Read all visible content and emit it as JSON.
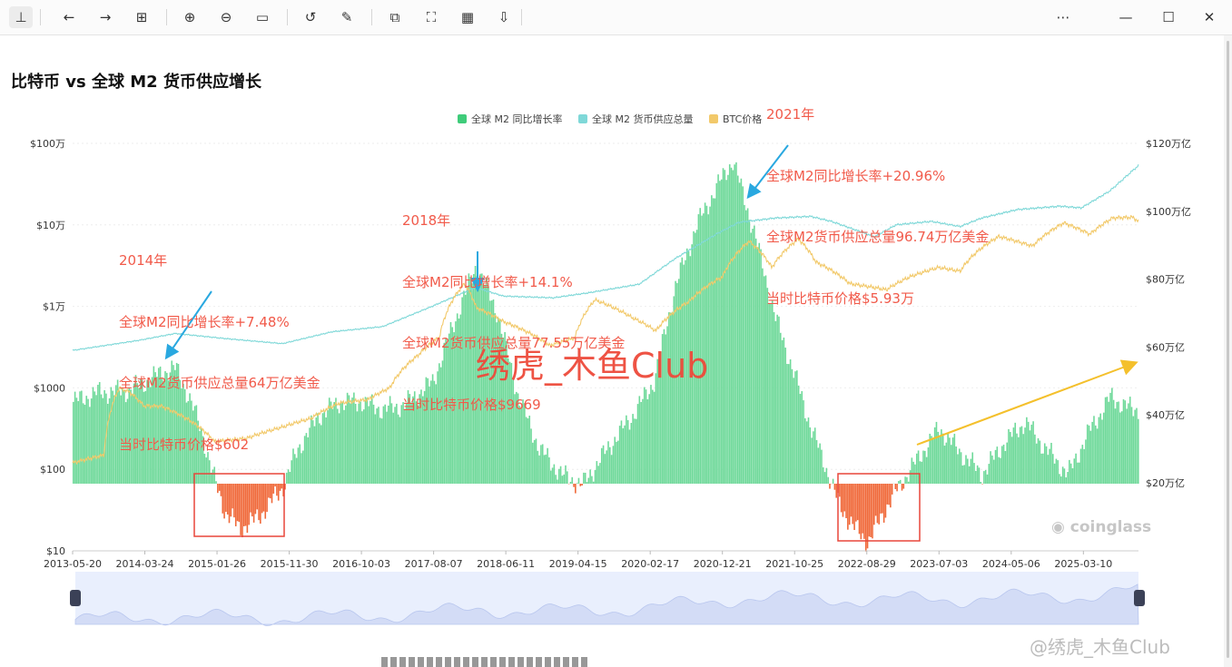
{
  "toolbar": {
    "items": [
      {
        "name": "pin-icon",
        "glyph": "⊥"
      },
      {
        "name": "back-icon",
        "glyph": "←"
      },
      {
        "name": "forward-icon",
        "glyph": "→"
      },
      {
        "name": "grid-icon",
        "glyph": "⊞"
      },
      {
        "name": "zoom-in-icon",
        "glyph": "⊕"
      },
      {
        "name": "zoom-out-icon",
        "glyph": "⊖"
      },
      {
        "name": "fit-icon",
        "glyph": "▭"
      },
      {
        "name": "rotate-icon",
        "glyph": "↺"
      },
      {
        "name": "edit-icon",
        "glyph": "✎"
      },
      {
        "name": "crop-icon",
        "glyph": "⧉"
      },
      {
        "name": "scan-icon",
        "glyph": "⛶"
      },
      {
        "name": "qr-icon",
        "glyph": "▦"
      },
      {
        "name": "download-icon",
        "glyph": "⇩"
      },
      {
        "name": "more-icon",
        "glyph": "⋯"
      },
      {
        "name": "minimize-icon",
        "glyph": "—"
      },
      {
        "name": "maximize-icon",
        "glyph": "☐"
      },
      {
        "name": "close-icon",
        "glyph": "✕"
      }
    ]
  },
  "page": {
    "watermark": "绣虎_木鱼Club",
    "logo": "coinglass",
    "source_watermark": "@绣虎_木鱼Club"
  },
  "annotations": [
    {
      "year": "2014年",
      "growth": "全球M2同比增长率+7.48%",
      "supply": "全球M2货币供应总量64万亿美金",
      "price": "当时比特币价格$602"
    },
    {
      "year": "2018年",
      "growth": "全球M2同比增长率+14.1%",
      "supply": "全球M2货币供应总量77.55万亿美金",
      "price": "当时比特币价格$9669"
    },
    {
      "year": "2021年",
      "growth": "全球M2同比增长率+20.96%",
      "supply": "全球M2货币供应总量96.74万亿美金",
      "price": "当时比特币价格$5.93万"
    }
  ],
  "colors": {
    "growth_pos": "#6fd99a",
    "growth_neg": "#f0693a",
    "supply": "#7fd8d8",
    "btc": "#f2c96a",
    "annotation": "#f15a4a",
    "arrow": "#29a8e0",
    "trend_arrow": "#f4c02c",
    "highlight_box": "#e8463a"
  },
  "chart_data": {
    "type": "bar",
    "title": "比特币 vs 全球 M2 货币供应增长",
    "legend": [
      "全球 M2 同比增长率",
      "全球 M2 货币供应总量",
      "BTC价格"
    ],
    "legend_position": "top-right",
    "x_ticks": [
      "2013-05-20",
      "2014-03-24",
      "2015-01-26",
      "2015-11-30",
      "2016-10-03",
      "2017-08-07",
      "2018-06-11",
      "2019-04-15",
      "2020-02-17",
      "2020-12-21",
      "2021-10-25",
      "2022-08-29",
      "2023-07-03",
      "2024-05-06",
      "2025-03-10"
    ],
    "x_range": [
      "2013-05-20",
      "2025-10-31"
    ],
    "y_left": {
      "label": "BTC价格",
      "scale": "log",
      "ticks": [
        "$10",
        "$100",
        "$1000",
        "$1万",
        "$10万",
        "$100万"
      ],
      "range": [
        10,
        1000000
      ]
    },
    "y_right": {
      "label": "全球 M2 货币供应总量",
      "ticks": [
        "$20万亿",
        "$40万亿",
        "$60万亿",
        "$80万亿",
        "$100万亿",
        "$120万亿"
      ],
      "range": [
        20,
        120
      ],
      "unit": "万亿"
    },
    "series": [
      {
        "name": "全球 M2 同比增长率",
        "type": "bar",
        "unit": "%",
        "points": [
          [
            "2013-05-20",
            5.3
          ],
          [
            "2013-09-01",
            5.9
          ],
          [
            "2014-01-01",
            6.0
          ],
          [
            "2014-03-01",
            6.4
          ],
          [
            "2014-06-01",
            7.2
          ],
          [
            "2014-08-01",
            7.48
          ],
          [
            "2014-09-20",
            5.8
          ],
          [
            "2014-11-15",
            3.6
          ],
          [
            "2015-01-01",
            0.8
          ],
          [
            "2015-03-01",
            -1.9
          ],
          [
            "2015-05-01",
            -2.9
          ],
          [
            "2015-07-01",
            -2.4
          ],
          [
            "2015-09-01",
            -1.4
          ],
          [
            "2015-11-01",
            -0.2
          ],
          [
            "2016-01-01",
            2.2
          ],
          [
            "2016-04-01",
            4.4
          ],
          [
            "2016-07-01",
            5.3
          ],
          [
            "2016-10-01",
            5.3
          ],
          [
            "2017-01-01",
            4.8
          ],
          [
            "2017-04-01",
            5.1
          ],
          [
            "2017-08-01",
            6.6
          ],
          [
            "2017-11-01",
            10.5
          ],
          [
            "2018-02-01",
            14.1
          ],
          [
            "2018-05-01",
            11.2
          ],
          [
            "2018-08-01",
            5.6
          ],
          [
            "2018-11-01",
            2.2
          ],
          [
            "2019-02-01",
            0.6
          ],
          [
            "2019-05-01",
            -0.1
          ],
          [
            "2019-09-01",
            2.6
          ],
          [
            "2019-12-01",
            4.4
          ],
          [
            "2020-03-01",
            6.6
          ],
          [
            "2020-06-01",
            12.8
          ],
          [
            "2020-09-01",
            16.8
          ],
          [
            "2020-12-01",
            19.4
          ],
          [
            "2021-02-01",
            20.96
          ],
          [
            "2021-05-01",
            16.4
          ],
          [
            "2021-08-01",
            10.8
          ],
          [
            "2021-11-01",
            6.6
          ],
          [
            "2022-01-01",
            3.6
          ],
          [
            "2022-03-01",
            1.2
          ],
          [
            "2022-05-01",
            -1.4
          ],
          [
            "2022-07-01",
            -2.8
          ],
          [
            "2022-09-01",
            -3.8
          ],
          [
            "2022-11-01",
            -2.0
          ],
          [
            "2023-01-01",
            -0.4
          ],
          [
            "2023-04-01",
            1.6
          ],
          [
            "2023-07-01",
            3.6
          ],
          [
            "2023-10-01",
            2.0
          ],
          [
            "2024-01-01",
            0.6
          ],
          [
            "2024-04-01",
            2.6
          ],
          [
            "2024-07-01",
            4.0
          ],
          [
            "2024-10-01",
            2.2
          ],
          [
            "2025-01-01",
            0.6
          ],
          [
            "2025-04-01",
            3.4
          ],
          [
            "2025-07-01",
            5.6
          ],
          [
            "2025-10-01",
            4.8
          ]
        ]
      },
      {
        "name": "全球 M2 货币供应总量",
        "type": "line",
        "unit": "万亿美元",
        "points": [
          [
            "2013-05-20",
            59.0
          ],
          [
            "2014-03-01",
            62.0
          ],
          [
            "2014-08-01",
            64.0
          ],
          [
            "2015-03-01",
            62.5
          ],
          [
            "2015-11-01",
            61.0
          ],
          [
            "2016-06-01",
            64.5
          ],
          [
            "2017-01-01",
            66.0
          ],
          [
            "2017-08-01",
            72.0
          ],
          [
            "2018-02-01",
            77.55
          ],
          [
            "2018-06-01",
            75.0
          ],
          [
            "2019-01-01",
            74.5
          ],
          [
            "2019-06-01",
            76.0
          ],
          [
            "2020-01-01",
            78.5
          ],
          [
            "2020-06-01",
            86.0
          ],
          [
            "2020-12-01",
            93.5
          ],
          [
            "2021-03-01",
            96.74
          ],
          [
            "2021-08-01",
            98.0
          ],
          [
            "2022-01-01",
            98.5
          ],
          [
            "2022-04-01",
            97.0
          ],
          [
            "2022-10-01",
            92.5
          ],
          [
            "2023-01-01",
            96.0
          ],
          [
            "2023-06-01",
            97.0
          ],
          [
            "2023-10-01",
            95.5
          ],
          [
            "2024-01-01",
            98.0
          ],
          [
            "2024-06-01",
            100.5
          ],
          [
            "2024-12-01",
            101.5
          ],
          [
            "2025-03-01",
            101.0
          ],
          [
            "2025-07-01",
            106.0
          ],
          [
            "2025-10-31",
            113.5
          ]
        ]
      },
      {
        "name": "BTC价格",
        "type": "line",
        "unit": "USD",
        "points": [
          [
            "2013-05-20",
            120
          ],
          [
            "2013-10-01",
            150
          ],
          [
            "2013-12-05",
            1000
          ],
          [
            "2014-01-15",
            900
          ],
          [
            "2014-03-20",
            602
          ],
          [
            "2014-06-01",
            600
          ],
          [
            "2014-09-01",
            450
          ],
          [
            "2015-01-15",
            220
          ],
          [
            "2015-06-01",
            240
          ],
          [
            "2015-11-01",
            330
          ],
          [
            "2016-03-01",
            420
          ],
          [
            "2016-07-01",
            650
          ],
          [
            "2016-11-01",
            720
          ],
          [
            "2017-02-01",
            1000
          ],
          [
            "2017-06-01",
            2500
          ],
          [
            "2017-09-01",
            4200
          ],
          [
            "2017-12-17",
            19000
          ],
          [
            "2018-02-05",
            9669
          ],
          [
            "2018-06-01",
            6500
          ],
          [
            "2018-12-15",
            3300
          ],
          [
            "2019-04-01",
            4100
          ],
          [
            "2019-06-26",
            12000
          ],
          [
            "2019-12-01",
            7300
          ],
          [
            "2020-03-12",
            5000
          ],
          [
            "2020-08-01",
            11500
          ],
          [
            "2020-12-21",
            23000
          ],
          [
            "2021-04-14",
            63000
          ],
          [
            "2021-07-20",
            30000
          ],
          [
            "2021-11-10",
            67000
          ],
          [
            "2022-01-24",
            35000
          ],
          [
            "2022-06-18",
            19000
          ],
          [
            "2022-11-21",
            16000
          ],
          [
            "2023-03-01",
            23000
          ],
          [
            "2023-07-01",
            30000
          ],
          [
            "2023-10-01",
            27000
          ],
          [
            "2024-03-14",
            72000
          ],
          [
            "2024-08-05",
            55000
          ],
          [
            "2024-12-17",
            106000
          ],
          [
            "2025-04-07",
            77000
          ],
          [
            "2025-07-14",
            122000
          ],
          [
            "2025-10-06",
            124000
          ],
          [
            "2025-10-31",
            110000
          ]
        ]
      }
    ],
    "annotated_points": [
      {
        "label": "2014年",
        "date": "2014-08-01",
        "growth": 7.48,
        "m2": 64,
        "btc": 602
      },
      {
        "label": "2018年",
        "date": "2018-02-01",
        "growth": 14.1,
        "m2": 77.55,
        "btc": 9669
      },
      {
        "label": "2021年",
        "date": "2021-02-01",
        "growth": 20.96,
        "m2": 96.74,
        "btc": 59300
      }
    ],
    "highlighted_ranges": [
      [
        "2015-01-01",
        "2015-12-01"
      ],
      [
        "2022-01-01",
        "2023-01-15"
      ]
    ],
    "trend_arrow": [
      "2023-01-15",
      "2025-10-31"
    ],
    "grid": true
  }
}
